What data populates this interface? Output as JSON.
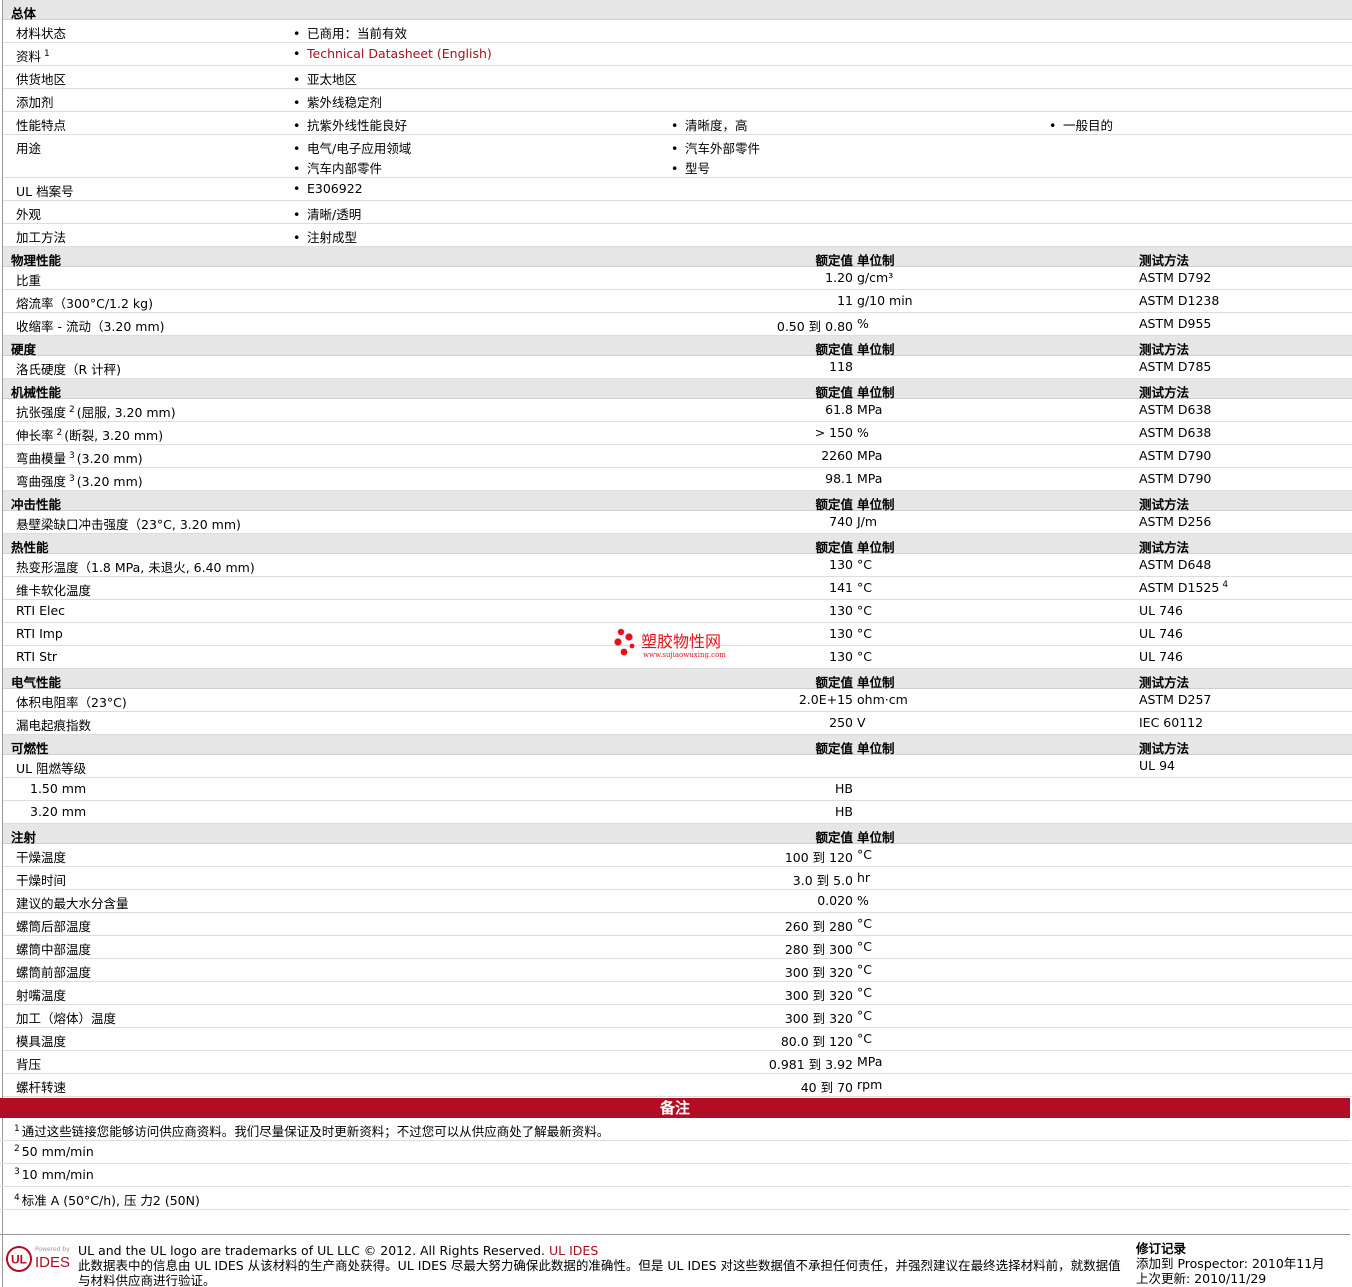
{
  "general": {
    "title": "总体",
    "rows": [
      {
        "label": "材料状态",
        "values": [
          "已商用：当前有效"
        ]
      },
      {
        "label": "资料",
        "sup": "1",
        "values": [
          "Technical Datasheet (English)"
        ],
        "link": true
      },
      {
        "label": "供货地区",
        "values": [
          "亚太地区"
        ]
      },
      {
        "label": "添加剂",
        "values": [
          "紫外线稳定剂"
        ]
      },
      {
        "label": "性能特点",
        "values": [
          "抗紫外线性能良好",
          "清晰度，高",
          "一般目的"
        ]
      },
      {
        "label": "用途",
        "values": [
          "电气/电子应用领域",
          "汽车外部零件",
          "汽车内部零件",
          "型号"
        ]
      },
      {
        "label": "UL 档案号",
        "values": [
          "E306922"
        ]
      },
      {
        "label": "外观",
        "values": [
          "清晰/透明"
        ]
      },
      {
        "label": "加工方法",
        "values": [
          "注射成型"
        ]
      }
    ]
  },
  "col_headers": {
    "nominal": "额定值",
    "unit": "单位制",
    "method": "测试方法"
  },
  "sections": [
    {
      "title": "物理性能",
      "method_header": true,
      "rows": [
        {
          "label": "比重",
          "value": "1.20",
          "unit": "g/cm³",
          "method": "ASTM D792"
        },
        {
          "label": "熔流率（300°C/1.2 kg)",
          "value": "11",
          "unit": "g/10 min",
          "method": "ASTM D1238"
        },
        {
          "label": "收缩率 - 流动（3.20 mm)",
          "value": "0.50 到  0.80",
          "unit": "%",
          "method": "ASTM D955"
        }
      ]
    },
    {
      "title": "硬度",
      "method_header": true,
      "rows": [
        {
          "label": "洛氏硬度（R 计秤)",
          "value": "118",
          "unit": "",
          "method": "ASTM D785"
        }
      ]
    },
    {
      "title": "机械性能",
      "method_header": true,
      "rows": [
        {
          "label": "抗张强度",
          "sup": "2",
          "label_tail": "(屈服, 3.20 mm)",
          "value": "61.8",
          "unit": "MPa",
          "method": "ASTM D638"
        },
        {
          "label": "伸长率",
          "sup": "2",
          "label_tail": "(断裂, 3.20 mm)",
          "value": "> 150",
          "unit": "%",
          "method": "ASTM D638"
        },
        {
          "label": "弯曲模量",
          "sup": "3",
          "label_tail": "(3.20 mm)",
          "value": "2260",
          "unit": "MPa",
          "method": "ASTM D790"
        },
        {
          "label": "弯曲强度",
          "sup": "3",
          "label_tail": "(3.20 mm)",
          "value": "98.1",
          "unit": "MPa",
          "method": "ASTM D790"
        }
      ]
    },
    {
      "title": "冲击性能",
      "method_header": true,
      "rows": [
        {
          "label": "悬壁梁缺口冲击强度（23°C, 3.20 mm)",
          "value": "740",
          "unit": "J/m",
          "method": "ASTM D256"
        }
      ]
    },
    {
      "title": "热性能",
      "method_header": true,
      "rows": [
        {
          "label": "热变形温度（1.8 MPa, 未退火, 6.40 mm)",
          "value": "130",
          "unit": "°C",
          "method": "ASTM D648"
        },
        {
          "label": "维卡软化温度",
          "value": "141",
          "unit": "°C",
          "method": "ASTM D1525",
          "method_sup": "4"
        },
        {
          "label": "RTI Elec",
          "value": "130",
          "unit": "°C",
          "method": "UL 746"
        },
        {
          "label": "RTI Imp",
          "value": "130",
          "unit": "°C",
          "method": "UL 746"
        },
        {
          "label": "RTI Str",
          "value": "130",
          "unit": "°C",
          "method": "UL 746"
        }
      ]
    },
    {
      "title": "电气性能",
      "method_header": true,
      "rows": [
        {
          "label": "体积电阻率（23°C)",
          "value": "2.0E+15",
          "unit": "ohm·cm",
          "method": "ASTM D257"
        },
        {
          "label": "漏电起痕指数",
          "value": "250",
          "unit": "V",
          "method": "IEC 60112"
        }
      ]
    },
    {
      "title": "可燃性",
      "method_header": true,
      "rows": [
        {
          "label": "UL 阻燃等级",
          "value": "",
          "unit": "",
          "method": "UL 94"
        },
        {
          "label": "1.50 mm",
          "value": "HB",
          "unit": "",
          "method": "",
          "indent": true
        },
        {
          "label": "3.20 mm",
          "value": "HB",
          "unit": "",
          "method": "",
          "indent": true
        }
      ]
    },
    {
      "title": "注射",
      "method_header": false,
      "rows": [
        {
          "label": "干燥温度",
          "value": "100 到  120",
          "unit": "°C",
          "method": ""
        },
        {
          "label": "干燥时间",
          "value": "3.0 到  5.0",
          "unit": "hr",
          "method": ""
        },
        {
          "label": "建议的最大水分含量",
          "value": "0.020",
          "unit": "%",
          "method": ""
        },
        {
          "label": "螺筒后部温度",
          "value": "260 到  280",
          "unit": "°C",
          "method": ""
        },
        {
          "label": "螺筒中部温度",
          "value": "280 到  300",
          "unit": "°C",
          "method": ""
        },
        {
          "label": "螺筒前部温度",
          "value": "300 到  320",
          "unit": "°C",
          "method": ""
        },
        {
          "label": "射嘴温度",
          "value": "300 到  320",
          "unit": "°C",
          "method": ""
        },
        {
          "label": "加工（熔体）温度",
          "value": "300 到  320",
          "unit": "°C",
          "method": ""
        },
        {
          "label": "模具温度",
          "value": "80.0 到  120",
          "unit": "°C",
          "method": ""
        },
        {
          "label": "背压",
          "value": "0.981 到  3.92",
          "unit": "MPa",
          "method": ""
        },
        {
          "label": "螺杆转速",
          "value": "40 到  70",
          "unit": "rpm",
          "method": ""
        }
      ]
    }
  ],
  "notes": {
    "title": "备注",
    "items": [
      {
        "num": "1",
        "text": "通过这些链接您能够访问供应商资料。我们尽量保证及时更新资料；不过您可以从供应商处了解最新资料。"
      },
      {
        "num": "2",
        "text": "50 mm/min"
      },
      {
        "num": "3",
        "text": "10 mm/min"
      },
      {
        "num": "4",
        "text": "标准  A (50°C/h), 压  力2 (50N)"
      }
    ]
  },
  "footer": {
    "logo_text": "IDES",
    "logo_small": "Powered by",
    "logo_ul": "UL",
    "trademark": "UL and the UL logo are trademarks of UL LLC © 2012. All Rights Reserved.",
    "trademark_link": "UL IDES",
    "disclaimer": "此数据表中的信息由  UL IDES 从该材料的生产商处获得。UL IDES 尽最大努力确保此数据的准确性。但是  UL IDES 对这些数据值不承担任何责任，并强烈建议在最终选择材料前，就数据值与材料供应商进行验证。",
    "revision_title": "修订记录",
    "added": "添加到  Prospector:   2010年11月",
    "updated": "上次更新:     2010/11/29"
  },
  "watermark": {
    "text": "塑胶物性网",
    "url": "www.sujiaowuxing.com"
  },
  "colors": {
    "accent": "#b20d25",
    "link": "#a50f22",
    "section_bg": "#e6e6e6"
  }
}
